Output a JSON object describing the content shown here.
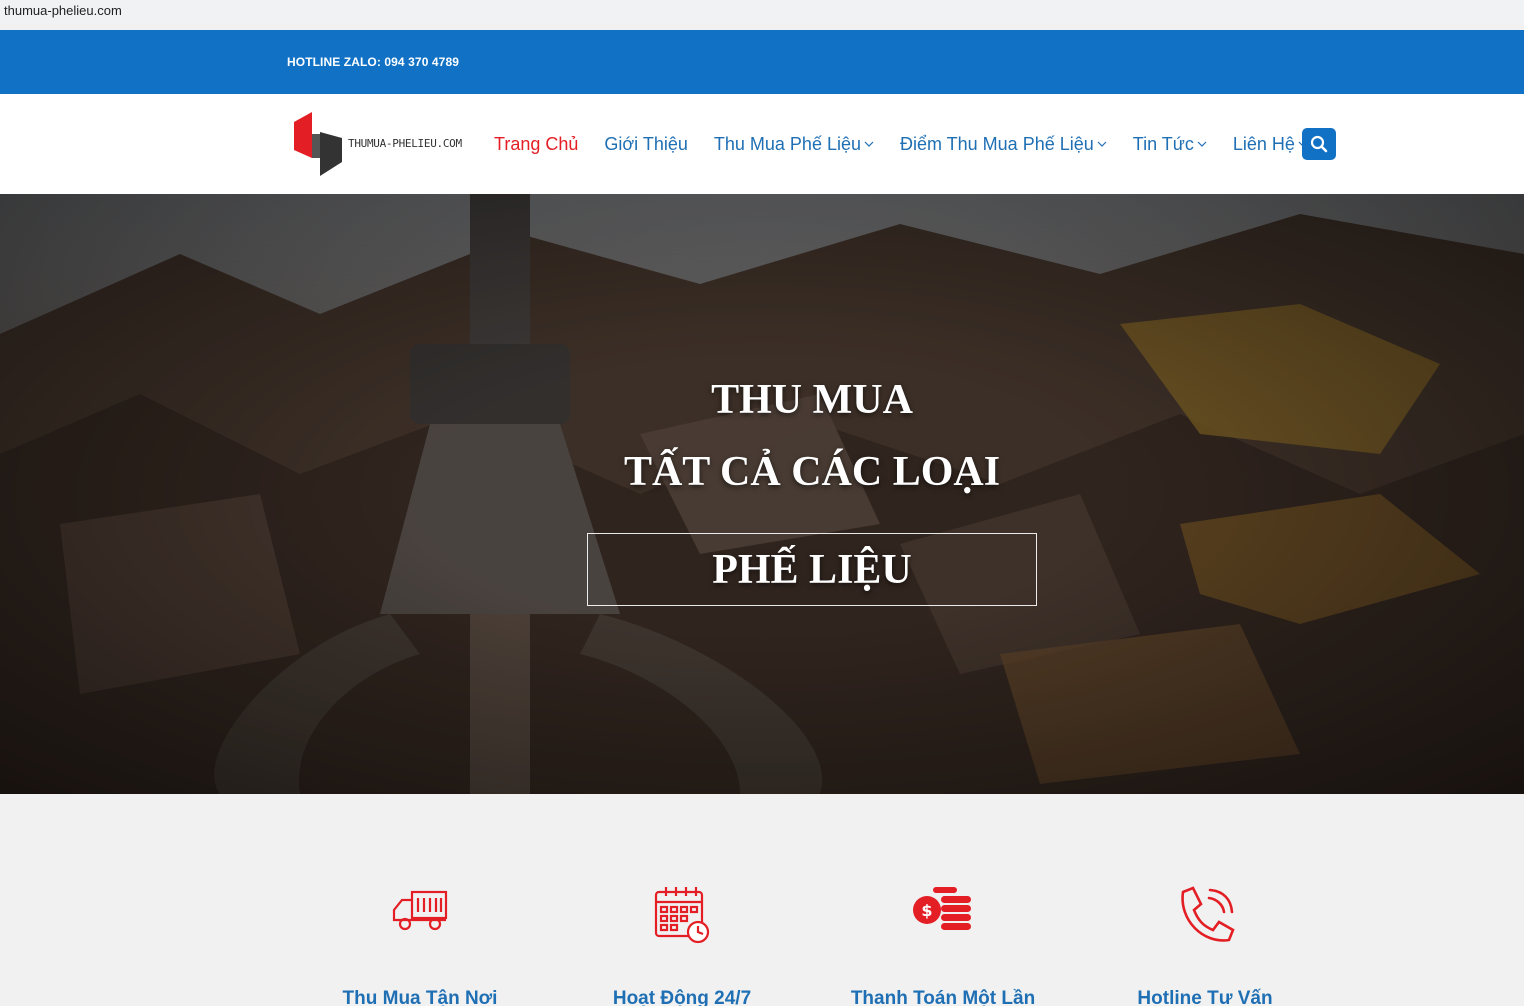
{
  "browser": {
    "url": "thumua-phelieu.com"
  },
  "topbar": {
    "hotline": "HOTLINE ZALO: 094 370 4789"
  },
  "logo": {
    "text": "THUMUA-PHELIEU.COM"
  },
  "nav": {
    "items": [
      {
        "label": "Trang Chủ",
        "active": true,
        "dropdown": false
      },
      {
        "label": "Giới Thiệu",
        "active": false,
        "dropdown": false
      },
      {
        "label": "Thu Mua Phế Liệu",
        "active": false,
        "dropdown": true
      },
      {
        "label": "Điểm Thu Mua Phế Liệu",
        "active": false,
        "dropdown": true
      },
      {
        "label": "Tin Tức",
        "active": false,
        "dropdown": true
      },
      {
        "label": "Liên Hệ",
        "active": false,
        "dropdown": true
      }
    ]
  },
  "hero": {
    "line1": "THU MUA",
    "line2": "TẤT CẢ CÁC LOẠI",
    "line3": "PHẾ LIỆU"
  },
  "features": [
    {
      "label": "Thu Mua Tận Nơi",
      "icon": "truck-icon"
    },
    {
      "label": "Hoạt Động 24/7",
      "icon": "calendar-clock-icon"
    },
    {
      "label": "Thanh Toán Một Lần",
      "icon": "coins-icon"
    },
    {
      "label": "Hotline Tư Vấn",
      "icon": "phone-icon"
    }
  ],
  "colors": {
    "brand_blue": "#1171c5",
    "accent_red": "#e31e24",
    "link_blue": "#1f6fb4"
  }
}
